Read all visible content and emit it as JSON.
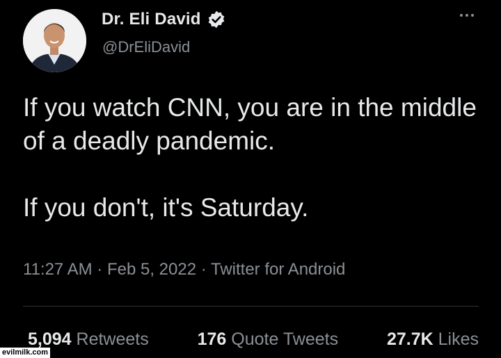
{
  "author": {
    "name": "Dr. Eli David",
    "handle": "@DrEliDavid",
    "verified_color": "#e7e9ea"
  },
  "icons": {
    "avatar": "profile-photo",
    "verified": "verified-badge-icon",
    "more": "more-options-icon"
  },
  "tweet": {
    "text": "If you watch CNN, you are in the middle of a deadly pandemic.\n\nIf you don't, it's Saturday.",
    "time": "11:27 AM",
    "separator": "·",
    "date": "Feb 5, 2022",
    "source": "Twitter for Android"
  },
  "stats": {
    "retweets_count": "5,094",
    "retweets_label": "Retweets",
    "quotes_count": "176",
    "quotes_label": "Quote Tweets",
    "likes_count": "27.7K",
    "likes_label": "Likes"
  },
  "watermark": "evilmilk.com"
}
